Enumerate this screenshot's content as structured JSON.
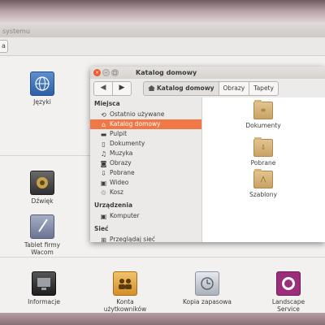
{
  "background_window": {
    "title": "systemu",
    "toolbar_button": "a",
    "launchers_row1": [
      {
        "label": "Języki",
        "icon": "globe-flag-icon",
        "color": "#3b6fb6"
      }
    ],
    "launchers_row2": [
      {
        "label": "Dźwięk",
        "icon": "speaker-icon",
        "color": "#3c3c3c"
      },
      {
        "label": "Tablet firmy Wacom",
        "icon": "tablet-pen-icon",
        "color": "#7f88a8"
      }
    ],
    "launchers_row3": [
      {
        "label": "Informacje",
        "icon": "system-info-icon",
        "color": "#2d2d2d"
      },
      {
        "label": "Konta użytkowników",
        "icon": "users-icon",
        "color": "#e0a23a"
      },
      {
        "label": "Kopia zapasowa",
        "icon": "backup-clock-icon",
        "color": "#b9c0c8"
      },
      {
        "label": "Landscape Service",
        "icon": "landscape-icon",
        "color": "#9b2d7a"
      }
    ]
  },
  "file_window": {
    "title": "Katalog domowy",
    "toolbar": {
      "back_label": "◀",
      "forward_label": "▶",
      "breadcrumbs": [
        "Katalog domowy",
        "Obrazy",
        "Tapety"
      ]
    },
    "sidebar": {
      "places_header": "Miejsca",
      "places": [
        {
          "label": "Ostatnio używane",
          "icon": "recent-icon",
          "glyph": "⟲"
        },
        {
          "label": "Katalog domowy",
          "icon": "home-icon",
          "glyph": "⌂",
          "selected": true
        },
        {
          "label": "Pulpit",
          "icon": "desktop-icon",
          "glyph": "▬"
        },
        {
          "label": "Dokumenty",
          "icon": "documents-icon",
          "glyph": "▯"
        },
        {
          "label": "Muzyka",
          "icon": "music-icon",
          "glyph": "♫"
        },
        {
          "label": "Obrazy",
          "icon": "camera-icon",
          "glyph": "◙"
        },
        {
          "label": "Pobrane",
          "icon": "download-icon",
          "glyph": "⇩"
        },
        {
          "label": "Wideo",
          "icon": "video-icon",
          "glyph": "▣"
        },
        {
          "label": "Kosz",
          "icon": "trash-icon",
          "glyph": "♲"
        }
      ],
      "devices_header": "Urządzenia",
      "devices": [
        {
          "label": "Komputer",
          "icon": "computer-icon",
          "glyph": "▣"
        }
      ],
      "network_header": "Sieć",
      "network": [
        {
          "label": "Przeglądaj sieć",
          "icon": "network-icon",
          "glyph": "⊞"
        }
      ]
    },
    "folders": [
      {
        "label": "Dokumenty",
        "glyph": "≡"
      },
      {
        "label": "Pobrane",
        "glyph": "⇩"
      },
      {
        "label": "Szablony",
        "glyph": "⋀"
      }
    ],
    "accent_color": "#f07746"
  }
}
